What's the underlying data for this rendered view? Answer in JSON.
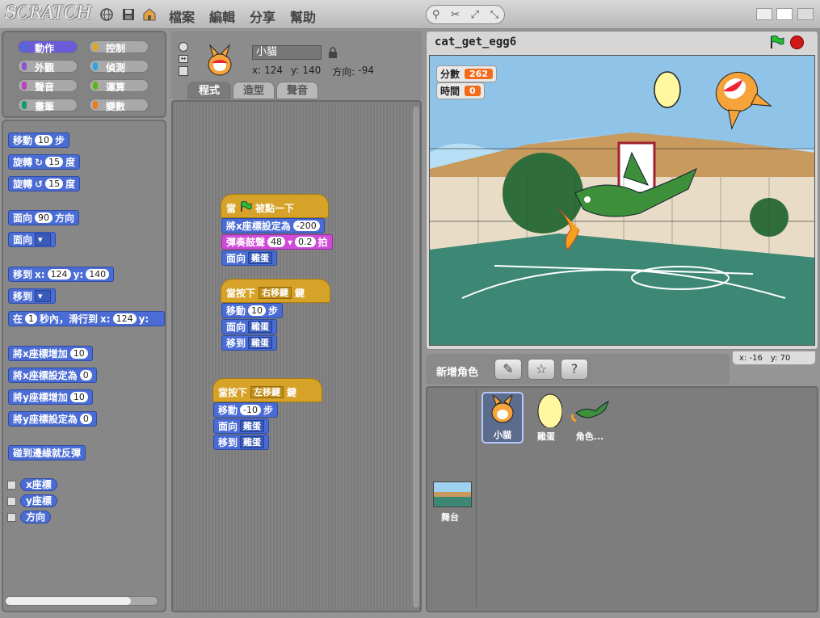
{
  "app": {
    "logo": "SCRATCH"
  },
  "menu": {
    "file": "檔案",
    "edit": "編輯",
    "share": "分享",
    "help": "幫助"
  },
  "categories": [
    {
      "label": "動作",
      "color": "#4a6cd4",
      "selected": true
    },
    {
      "label": "控制",
      "color": "#e1a91a"
    },
    {
      "label": "外觀",
      "color": "#8a55d7"
    },
    {
      "label": "偵測",
      "color": "#2ca5e2"
    },
    {
      "label": "聲音",
      "color": "#bb42c3"
    },
    {
      "label": "運算",
      "color": "#5cb712"
    },
    {
      "label": "畫筆",
      "color": "#0e9a6c"
    },
    {
      "label": "變數",
      "color": "#ee7d16"
    }
  ],
  "palette": {
    "move": {
      "label": "移動",
      "value": "10",
      "unit": "步"
    },
    "turn_right": {
      "label": "旋轉",
      "value": "15",
      "unit": "度"
    },
    "turn_left": {
      "label": "旋轉",
      "value": "15",
      "unit": "度"
    },
    "point_dir": {
      "label": "面向",
      "value": "90",
      "unit": "方向"
    },
    "point_towards": {
      "label": "面向"
    },
    "goto_xy": {
      "label": "移到",
      "x_label": "x:",
      "x": "124",
      "y_label": "y:",
      "y": "140"
    },
    "goto": {
      "label": "移到"
    },
    "glide": {
      "prefix": "在",
      "secs": "1",
      "mid": "秒內，滑行到",
      "x_label": "x:",
      "x": "124",
      "y_label": "y:"
    },
    "change_x": {
      "label": "將x座標增加",
      "value": "10"
    },
    "set_x": {
      "label": "將x座標設定為",
      "value": "0"
    },
    "change_y": {
      "label": "將y座標增加",
      "value": "10"
    },
    "set_y": {
      "label": "將y座標設定為",
      "value": "0"
    },
    "bounce": {
      "label": "碰到邊緣就反彈"
    },
    "rep_x": "x座標",
    "rep_y": "y座標",
    "rep_dir": "方向"
  },
  "sprite": {
    "name": "小貓",
    "x_label": "x:",
    "x": "124",
    "y_label": "y:",
    "y": "140",
    "dir_label": "方向:",
    "dir": "-94"
  },
  "tabs": {
    "scripts": "程式",
    "costumes": "造型",
    "sounds": "聲音"
  },
  "scripts": {
    "s1": {
      "hat_a": "當",
      "hat_b": "被點一下",
      "setx": "將x座標設定為",
      "setx_v": "-200",
      "drum": "彈奏鼓聲",
      "drum_v": "48",
      "drum_b": "0.2",
      "drum_u": "拍",
      "face": "面向",
      "face_v": "雞蛋"
    },
    "s2": {
      "hat_a": "當按下",
      "key": "右移鍵",
      "hat_b": "鍵",
      "move": "移動",
      "move_v": "10",
      "move_u": "步",
      "face": "面向",
      "face_v": "雞蛋",
      "goto": "移到",
      "goto_v": "雞蛋"
    },
    "s3": {
      "hat_a": "當按下",
      "key": "左移鍵",
      "hat_b": "鍵",
      "move": "移動",
      "move_v": "-10",
      "move_u": "步",
      "face": "面向",
      "face_v": "雞蛋",
      "goto": "移到",
      "goto_v": "雞蛋"
    }
  },
  "stage": {
    "project_name": "cat_get_egg6",
    "score_label": "分數",
    "score": "262",
    "time_label": "時間",
    "time": "0",
    "mouse_x_label": "x:",
    "mouse_x": "-16",
    "mouse_y_label": "y:",
    "mouse_y": "70"
  },
  "sprites_panel": {
    "new_sprite_label": "新增角色",
    "stage_label": "舞台",
    "sprites": [
      {
        "name": "小貓",
        "selected": true
      },
      {
        "name": "雞蛋"
      },
      {
        "name": "角色..."
      }
    ]
  }
}
